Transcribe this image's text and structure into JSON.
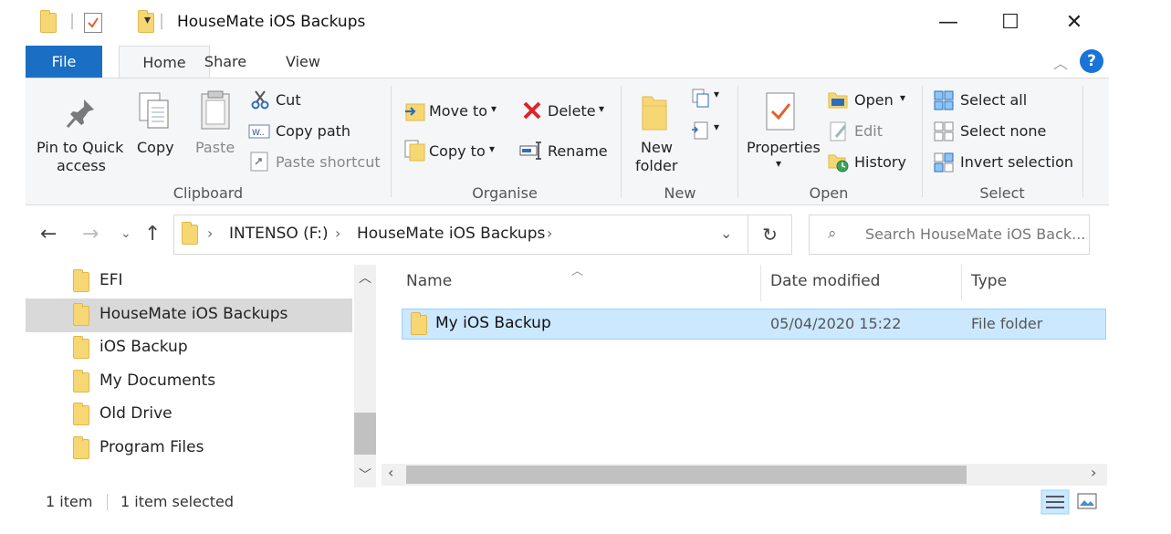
{
  "window": {
    "title": "HouseMate iOS Backups",
    "minimize": "—",
    "maximize": "☐",
    "close": "✕"
  },
  "tabs": [
    {
      "label": "File"
    },
    {
      "label": "Home"
    },
    {
      "label": "Share"
    },
    {
      "label": "View"
    }
  ],
  "ribbon": {
    "clipboard": {
      "pin_line1": "Pin to Quick",
      "pin_line2": "access",
      "copy": "Copy",
      "paste": "Paste",
      "cut": "Cut",
      "copy_path": "Copy path",
      "paste_shortcut": "Paste shortcut",
      "label": "Clipboard"
    },
    "organise": {
      "move_to": "Move to",
      "copy_to": "Copy to",
      "delete": "Delete",
      "rename": "Rename",
      "label": "Organise"
    },
    "new": {
      "new_line1": "New",
      "new_line2": "folder",
      "label": "New"
    },
    "open": {
      "properties": "Properties",
      "open": "Open",
      "edit": "Edit",
      "history": "History",
      "label": "Open"
    },
    "select": {
      "select_all": "Select all",
      "select_none": "Select none",
      "invert_selection": "Invert selection",
      "label": "Select"
    }
  },
  "address": {
    "segments": [
      "INTENSO (F:)",
      "HouseMate iOS Backups"
    ],
    "search_placeholder": "Search HouseMate iOS Back..."
  },
  "nav": {
    "items": [
      {
        "label": "EFI"
      },
      {
        "label": "HouseMate iOS Backups"
      },
      {
        "label": "iOS Backup"
      },
      {
        "label": "My Documents"
      },
      {
        "label": "Old Drive"
      },
      {
        "label": "Program Files"
      }
    ]
  },
  "list": {
    "columns": [
      "Name",
      "Date modified",
      "Type"
    ],
    "rows": [
      {
        "name": "My iOS Backup",
        "date": "05/04/2020 15:22",
        "type": "File folder"
      }
    ]
  },
  "status": {
    "count": "1 item",
    "selected": "1 item selected"
  },
  "colors": {
    "accent": "#1a6fc4",
    "selection": "#cce8ff",
    "folder": "#f7d774",
    "help": "#1a73d9",
    "delete": "#d9262b"
  }
}
